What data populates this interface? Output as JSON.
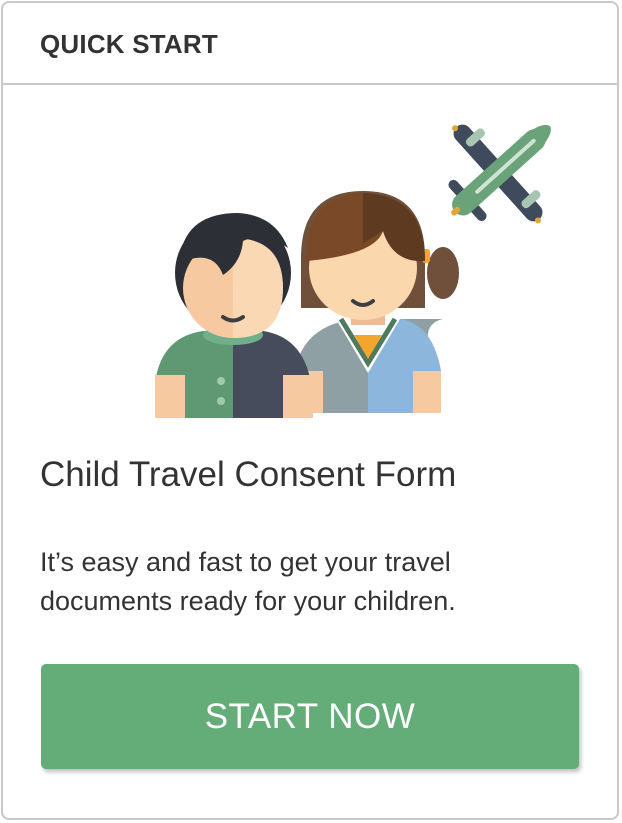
{
  "header": {
    "title": "QUICK START"
  },
  "illustration": {
    "icons": [
      "boy-icon",
      "girl-icon",
      "airplane-icon"
    ]
  },
  "card": {
    "title": "Child Travel Consent Form",
    "description": "It’s easy and fast to get your travel documents ready for your children.",
    "button_label": "START NOW"
  },
  "colors": {
    "accent": "#64ad79",
    "border": "#c9c9c9",
    "text": "#333333"
  }
}
